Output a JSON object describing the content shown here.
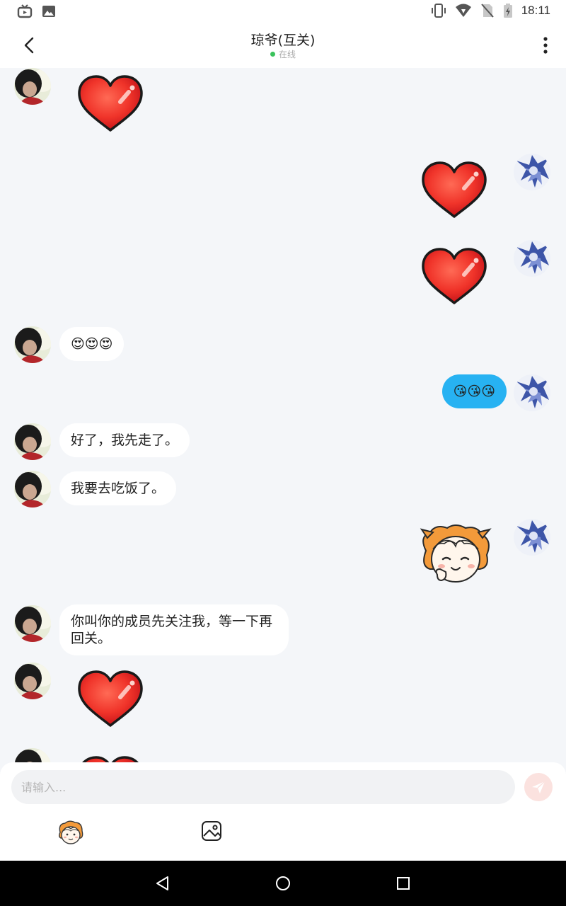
{
  "status_bar": {
    "time": "18:11",
    "icons": [
      "tv-icon",
      "image-icon",
      "vibrate-icon",
      "wifi-icon",
      "no-sim-icon",
      "battery-charging-icon"
    ]
  },
  "header": {
    "title": "琼爷(互关)",
    "status": "在线",
    "status_color": "#3ac25b"
  },
  "messages": [
    {
      "side": "left",
      "type": "sticker",
      "sticker": "red-heart"
    },
    {
      "side": "right",
      "type": "sticker",
      "sticker": "red-heart"
    },
    {
      "side": "right",
      "type": "sticker",
      "sticker": "red-heart"
    },
    {
      "side": "left",
      "type": "text",
      "text": "😍😍😍"
    },
    {
      "side": "right",
      "type": "text",
      "text": "😘😘😘"
    },
    {
      "side": "left",
      "type": "text",
      "text": "好了，我先走了。"
    },
    {
      "side": "left",
      "type": "text",
      "text": "我要去吃饭了。"
    },
    {
      "side": "right",
      "type": "sticker",
      "sticker": "anime-girl-wink"
    },
    {
      "side": "left",
      "type": "text",
      "text": "你叫你的成员先关注我，等一下再回关。"
    },
    {
      "side": "left",
      "type": "sticker",
      "sticker": "red-heart"
    },
    {
      "side": "left",
      "type": "sticker",
      "sticker": "red-heart"
    }
  ],
  "composer": {
    "placeholder": "请输入...",
    "value": "",
    "send_color": "#fbe2df"
  },
  "colors": {
    "chat_bg": "#f4f6f9",
    "bubble_right": "#27b2f2",
    "bubble_left": "#ffffff"
  }
}
